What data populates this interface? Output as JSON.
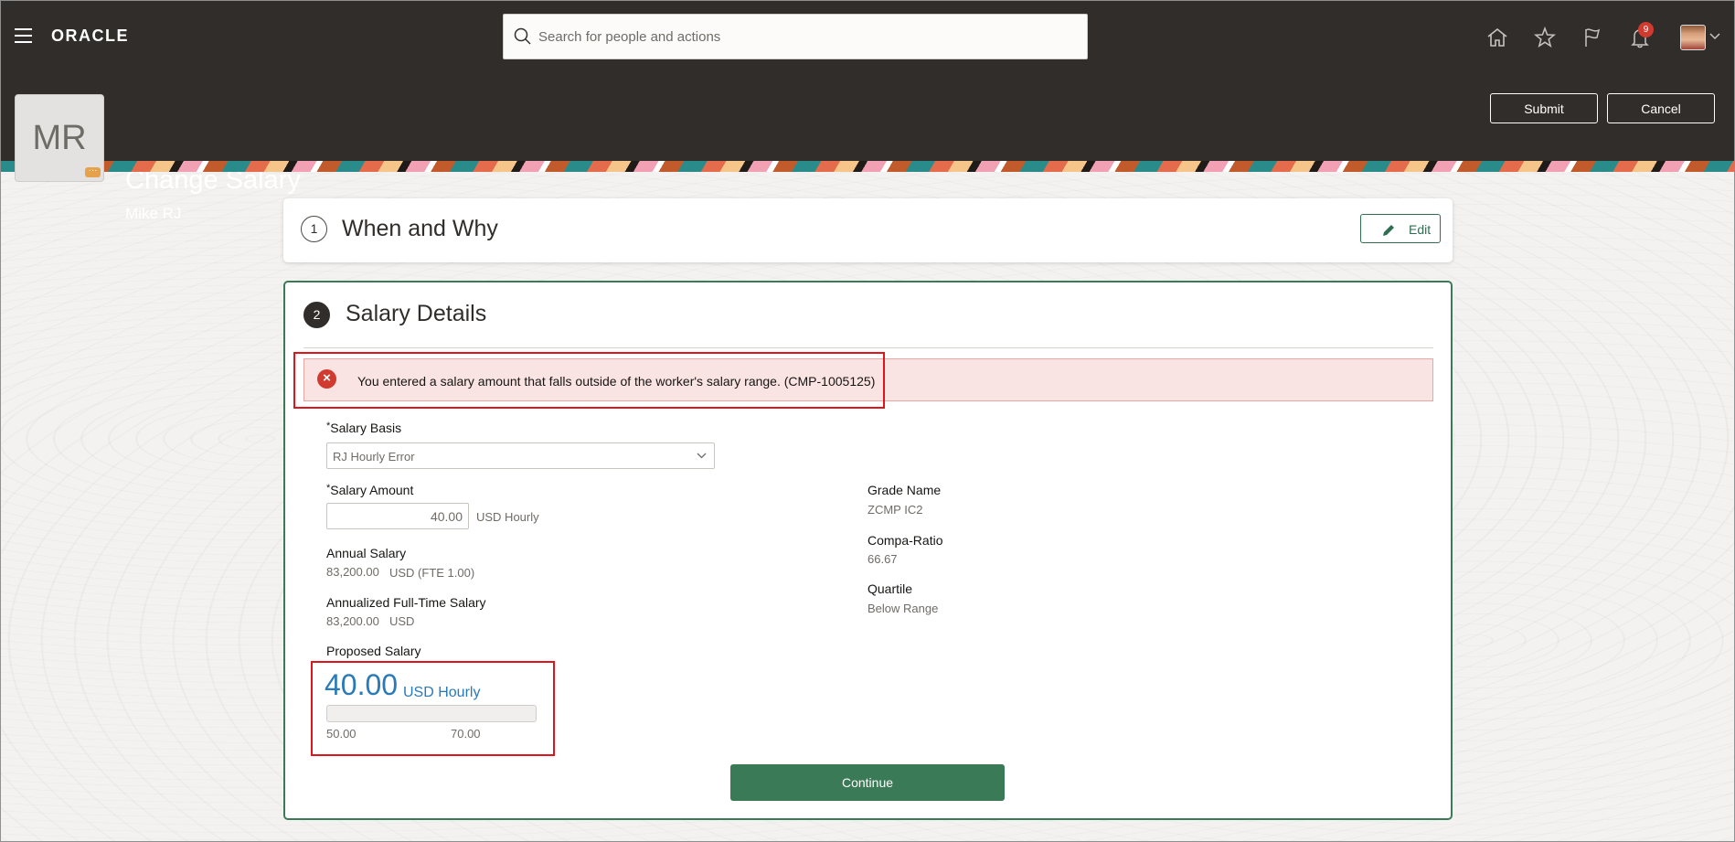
{
  "global_header": {
    "logo": "ORACLE",
    "search_placeholder": "Search for people and actions",
    "notification_count": "9"
  },
  "page_header": {
    "avatar_initials": "MR",
    "title": "Change Salary",
    "subtitle": "Mike RJ",
    "submit_label": "Submit",
    "cancel_label": "Cancel"
  },
  "section1": {
    "step": "1",
    "title": "When and Why",
    "edit_label": "Edit"
  },
  "section2": {
    "step": "2",
    "title": "Salary Details",
    "error_message": "You entered a salary amount that falls outside of the worker's salary range. (CMP-1005125)",
    "salary_basis": {
      "label": "Salary Basis",
      "required": "*",
      "value": "RJ Hourly Error"
    },
    "salary_amount": {
      "label": "Salary Amount",
      "required": "*",
      "value": "40.00",
      "unit": "USD Hourly"
    },
    "annual_salary": {
      "label": "Annual Salary",
      "value": "83,200.00",
      "unit": "USD (FTE 1.00)"
    },
    "annualized_full_time": {
      "label": "Annualized Full-Time Salary",
      "value": "83,200.00",
      "unit": "USD"
    },
    "proposed_salary": {
      "label": "Proposed Salary",
      "value": "40.00",
      "unit": "USD Hourly",
      "range_min": "50.00",
      "range_max": "70.00"
    },
    "grade_name": {
      "label": "Grade Name",
      "value": "ZCMP IC2"
    },
    "compa_ratio": {
      "label": "Compa-Ratio",
      "value": "66.67"
    },
    "quartile": {
      "label": "Quartile",
      "value": "Below Range"
    },
    "continue_label": "Continue"
  }
}
